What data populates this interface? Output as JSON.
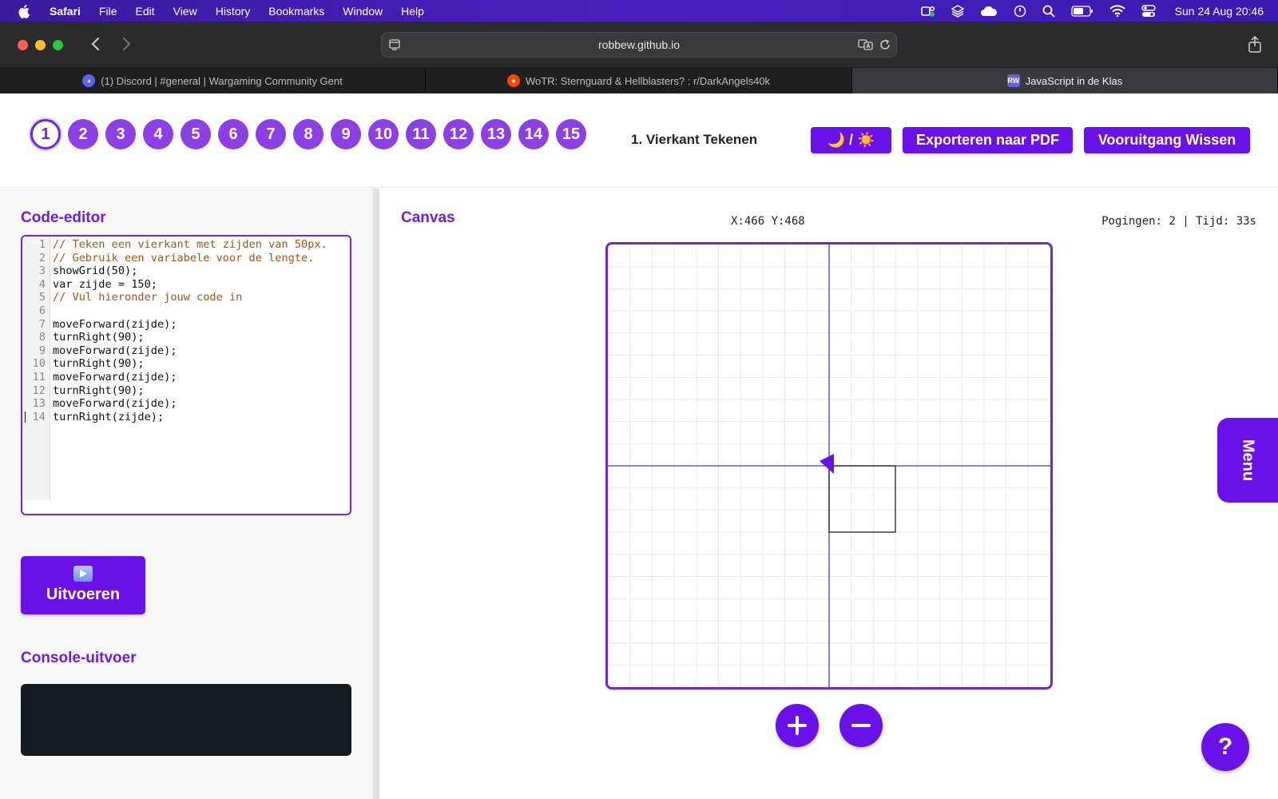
{
  "menubar": {
    "app_name": "Safari",
    "items": [
      "File",
      "Edit",
      "View",
      "History",
      "Bookmarks",
      "Window",
      "Help"
    ],
    "clock": "Sun 24 Aug  20:46"
  },
  "browser": {
    "url": "robbew.github.io",
    "tabs": [
      {
        "label": "(1) Discord | #general | Wargaming Community Gent",
        "icon": "discord-icon"
      },
      {
        "label": "WoTR: Sternguard & Hellblasters? : r/DarkAngels40k",
        "icon": "reddit-icon"
      },
      {
        "label": "JavaScript in de Klas",
        "icon": "rw-icon",
        "favicon_text": "RW"
      }
    ]
  },
  "app": {
    "levels": [
      "1",
      "2",
      "3",
      "4",
      "5",
      "6",
      "7",
      "8",
      "9",
      "10",
      "11",
      "12",
      "13",
      "14",
      "15"
    ],
    "active_level": 1,
    "lesson_title": "1. Vierkant Tekenen",
    "theme_toggle_label": "🌙 / ☀️",
    "export_label": "Exporteren naar PDF",
    "reset_label": "Vooruitgang Wissen",
    "accent_color": "#6a10e8"
  },
  "editor": {
    "title": "Code-editor",
    "lines": [
      {
        "n": "1",
        "text": "// Teken een vierkant met zijden van 50px.",
        "comment": true
      },
      {
        "n": "2",
        "text": "// Gebruik een variabele voor de lengte.",
        "comment": true
      },
      {
        "n": "3",
        "text": "showGrid(50);",
        "comment": false
      },
      {
        "n": "4",
        "text": "var zijde = 150;",
        "comment": false
      },
      {
        "n": "5",
        "text": "// Vul hieronder jouw code in",
        "comment": true
      },
      {
        "n": "6",
        "text": "",
        "comment": false
      },
      {
        "n": "7",
        "text": "moveForward(zijde);",
        "comment": false
      },
      {
        "n": "8",
        "text": "turnRight(90);",
        "comment": false
      },
      {
        "n": "9",
        "text": "moveForward(zijde);",
        "comment": false
      },
      {
        "n": "10",
        "text": "turnRight(90);",
        "comment": false
      },
      {
        "n": "11",
        "text": "moveForward(zijde);",
        "comment": false
      },
      {
        "n": "12",
        "text": "turnRight(90);",
        "comment": false
      },
      {
        "n": "13",
        "text": "moveForward(zijde);",
        "comment": false
      },
      {
        "n": "14",
        "text": "turnRight(zijde);",
        "comment": false
      }
    ],
    "run_label": "Uitvoeren",
    "console_title": "Console-uitvoer"
  },
  "canvas": {
    "title": "Canvas",
    "coords": "X:466 Y:468",
    "stats": "Pogingen: 2 | Tijd: 33s",
    "turtle_icon": "turtle-arrow-icon"
  },
  "side": {
    "menu_label": "Menu",
    "help_label": "?"
  }
}
